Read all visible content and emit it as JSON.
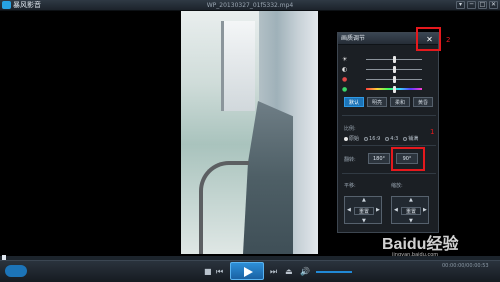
{
  "titlebar": {
    "app_name": "暴风影音",
    "file_title": "WP_20130327_01f5332.mp4",
    "window_buttons": [
      "▾",
      "─",
      "□",
      "✕"
    ]
  },
  "panel": {
    "title": "画质调节",
    "close": "✕",
    "sliders": [
      {
        "icon": "brightness-icon",
        "glyph": "☀",
        "level": 0.5
      },
      {
        "icon": "contrast-icon",
        "glyph": "◐",
        "level": 0.5
      },
      {
        "icon": "saturation-icon",
        "glyph": "●",
        "level": 0.5
      },
      {
        "icon": "hue-icon",
        "glyph": "●",
        "level": 0.5
      }
    ],
    "presets": [
      "默认",
      "明亮",
      "柔和",
      "黄昏"
    ],
    "ratio_label": "比例:",
    "ratio_options": [
      "原始",
      "16:9",
      "4:3",
      "铺满"
    ],
    "rotate_label": "翻转:",
    "rotate_180": "180°",
    "rotate_90": "90°",
    "pan_label": "平移:",
    "zoom_label": "缩放:",
    "reset": "重置"
  },
  "markers": {
    "close": "2",
    "rotate": "1"
  },
  "controls": {
    "stop": "■",
    "prev": "⏮",
    "next": "⏭",
    "eject": "⏏",
    "volume": "🔊",
    "time": "00:00:00/00:00:53"
  },
  "watermark": {
    "text": "Baidu经验",
    "sub": "jingyan.baidu.com"
  },
  "colors": {
    "accent": "#1c74b8",
    "highlight": "#e5191d"
  }
}
